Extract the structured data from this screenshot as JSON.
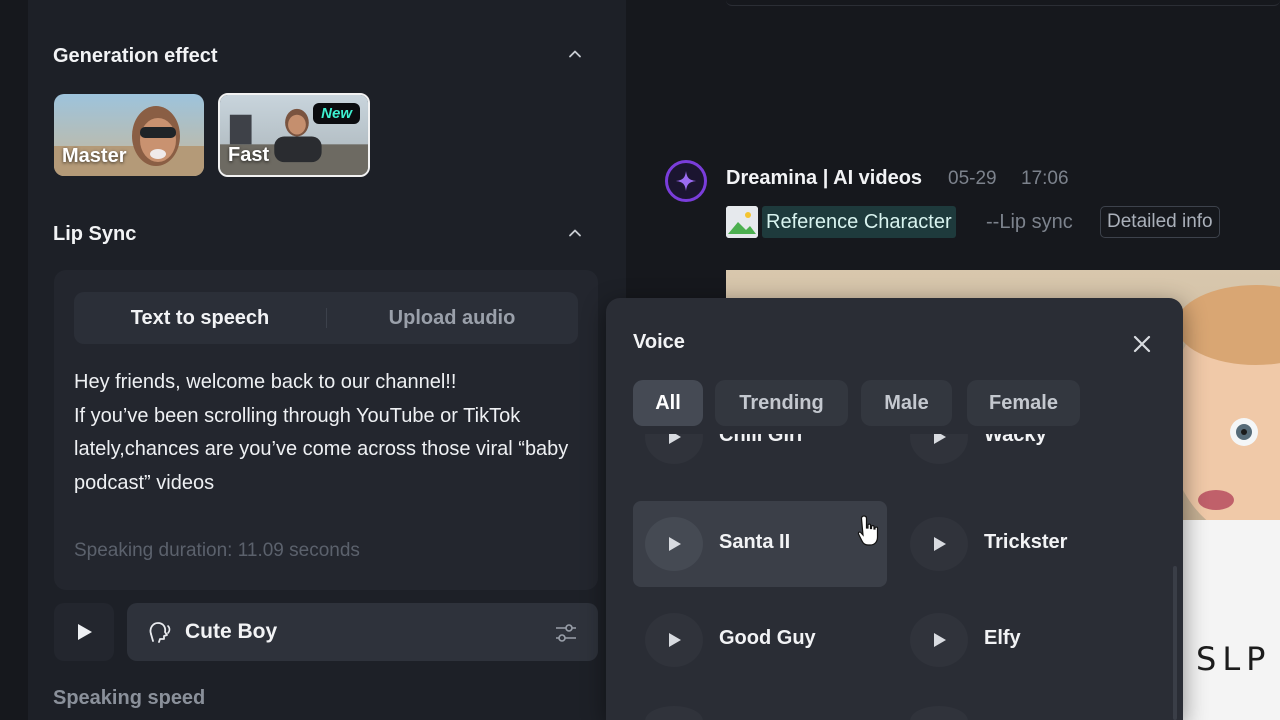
{
  "generation_effect": {
    "title": "Generation effect",
    "options": [
      {
        "label": "Master",
        "selected": false
      },
      {
        "label": "Fast",
        "selected": true,
        "badge": "New"
      }
    ]
  },
  "lip_sync": {
    "title": "Lip Sync",
    "tabs": [
      {
        "label": "Text to speech",
        "active": true
      },
      {
        "label": "Upload audio",
        "active": false
      }
    ],
    "text": "Hey friends, welcome back to our channel!!\nIf you’ve been scrolling through YouTube or TikTok lately,chances are you’ve come across those viral “baby podcast” videos",
    "duration": "Speaking duration: 11.09 seconds",
    "voice": "Cute Boy",
    "speed_label": "Speaking speed"
  },
  "message": {
    "title": "Dreamina | AI videos",
    "date": "05-29",
    "time": "17:06",
    "reference": "Reference Character",
    "tag": "--Lip sync",
    "detail": "Detailed info"
  },
  "voice_popup": {
    "title": "Voice",
    "filters": [
      {
        "label": "All",
        "active": true
      },
      {
        "label": "Trending",
        "active": false
      },
      {
        "label": "Male",
        "active": false
      },
      {
        "label": "Female",
        "active": false
      }
    ],
    "voices": [
      {
        "name": "Chill Girl"
      },
      {
        "name": "Wacky"
      },
      {
        "name": "Santa II",
        "hover": true
      },
      {
        "name": "Trickster"
      },
      {
        "name": "Good Guy"
      },
      {
        "name": "Elfy"
      }
    ]
  },
  "colors": {
    "accent_purple": "#7a3ddb",
    "badge_teal": "#3ef0d0",
    "ref_chip_bg": "#1e3a3c"
  }
}
